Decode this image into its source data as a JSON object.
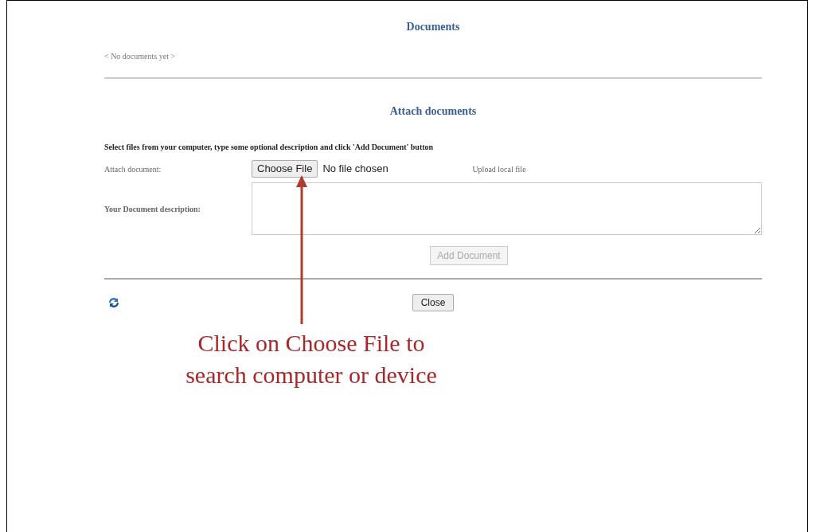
{
  "documents": {
    "title": "Documents",
    "empty_text": "< No documents yet >"
  },
  "attach": {
    "title": "Attach documents",
    "instruction": "Select files from your computer, type some optional description and click 'Add Document' button",
    "file_label": "Attach document:",
    "choose_button": "Choose File",
    "file_status": "No file chosen",
    "upload_hint": "Upload local file",
    "description_label": "Your Document description:",
    "add_button": {
      "label": "Add Document",
      "disabled": true
    }
  },
  "close_button": "Close",
  "annotation": {
    "lines": [
      "Click on Choose File to",
      "search computer or device"
    ]
  }
}
